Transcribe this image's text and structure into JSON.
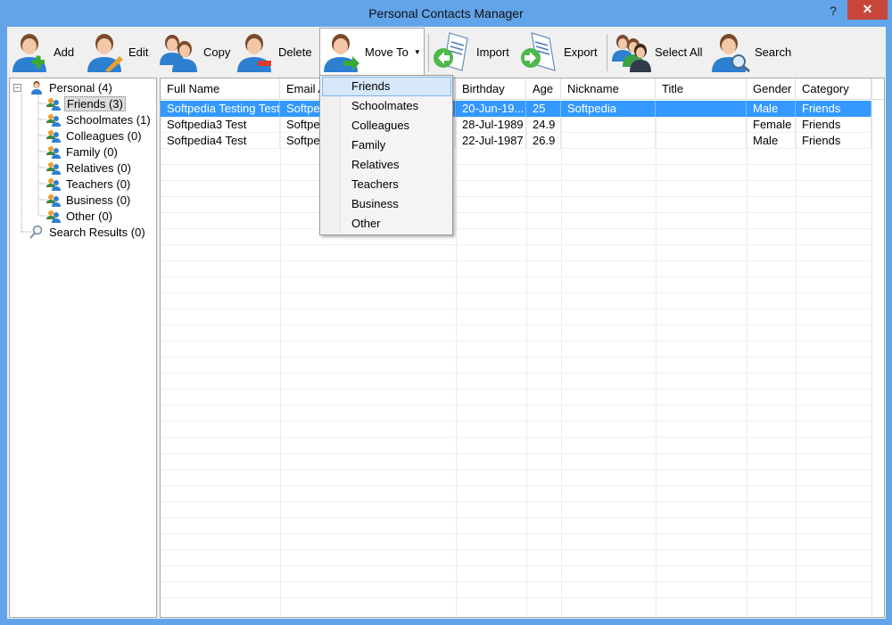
{
  "window": {
    "title": "Personal Contacts Manager",
    "help": "?",
    "close": "✕"
  },
  "toolbar": {
    "add": "Add",
    "edit": "Edit",
    "copy": "Copy",
    "delete": "Delete",
    "move_to": "Move To",
    "import": "Import",
    "export": "Export",
    "select_all": "Select All",
    "search": "Search"
  },
  "tree": {
    "root": "Personal (4)",
    "groups": [
      "Friends (3)",
      "Schoolmates (1)",
      "Colleagues (0)",
      "Family (0)",
      "Relatives (0)",
      "Teachers (0)",
      "Business (0)",
      "Other (0)"
    ],
    "search_results": "Search Results (0)"
  },
  "grid": {
    "columns": [
      "Full Name",
      "Email A",
      "",
      "Birthday",
      "Age",
      "Nickname",
      "Title",
      "Gender",
      "Category"
    ],
    "rows": [
      [
        "Softpedia Testing Test",
        "Softpe",
        "",
        "20-Jun-19...",
        "25",
        "Softpedia",
        "",
        "Male",
        "Friends"
      ],
      [
        "Softpedia3  Test",
        "Softpe",
        "",
        "28-Jul-1989",
        "24.9",
        "",
        "",
        "Female",
        "Friends"
      ],
      [
        "Softpedia4  Test",
        "Softpe",
        "",
        "22-Jul-1987",
        "26.9",
        "",
        "",
        "Male",
        "Friends"
      ]
    ]
  },
  "move_menu": {
    "items": [
      "Friends",
      "Schoolmates",
      "Colleagues",
      "Family",
      "Relatives",
      "Teachers",
      "Business",
      "Other"
    ]
  },
  "colors": {
    "title_bar": "#62a4ea",
    "close": "#c7463a",
    "selection": "#3399ff",
    "menu_hover": "#d6e8fa"
  }
}
